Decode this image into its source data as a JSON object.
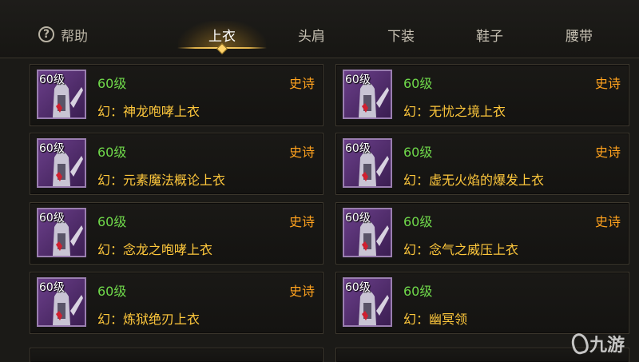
{
  "help": {
    "label": "帮助",
    "icon": "question-circle-icon"
  },
  "tabs": [
    {
      "label": "上衣",
      "active": true
    },
    {
      "label": "头肩",
      "active": false
    },
    {
      "label": "下装",
      "active": false
    },
    {
      "label": "鞋子",
      "active": false
    },
    {
      "label": "腰带",
      "active": false
    }
  ],
  "colors": {
    "level": "#6fd84a",
    "rarity": "#ffa21e",
    "name": "#ffc83c",
    "accent": "#e0b14a"
  },
  "items": [
    {
      "icon_level": "60级",
      "level": "60级",
      "rarity": "史诗",
      "name": "幻：神龙咆哮上衣"
    },
    {
      "icon_level": "60级",
      "level": "60级",
      "rarity": "史诗",
      "name": "幻：无忧之境上衣"
    },
    {
      "icon_level": "60级",
      "level": "60级",
      "rarity": "史诗",
      "name": "幻：元素魔法概论上衣"
    },
    {
      "icon_level": "60级",
      "level": "60级",
      "rarity": "史诗",
      "name": "幻：虚无火焰的爆发上衣"
    },
    {
      "icon_level": "60级",
      "level": "60级",
      "rarity": "史诗",
      "name": "幻：念龙之咆哮上衣"
    },
    {
      "icon_level": "60级",
      "level": "60级",
      "rarity": "史诗",
      "name": "幻：念气之威压上衣"
    },
    {
      "icon_level": "60级",
      "level": "60级",
      "rarity": "史诗",
      "name": "幻：炼狱绝刃上衣"
    },
    {
      "icon_level": "60级",
      "level": "60级",
      "rarity": "",
      "name": "幻：幽冥领"
    }
  ],
  "watermark": {
    "text": "九游"
  }
}
